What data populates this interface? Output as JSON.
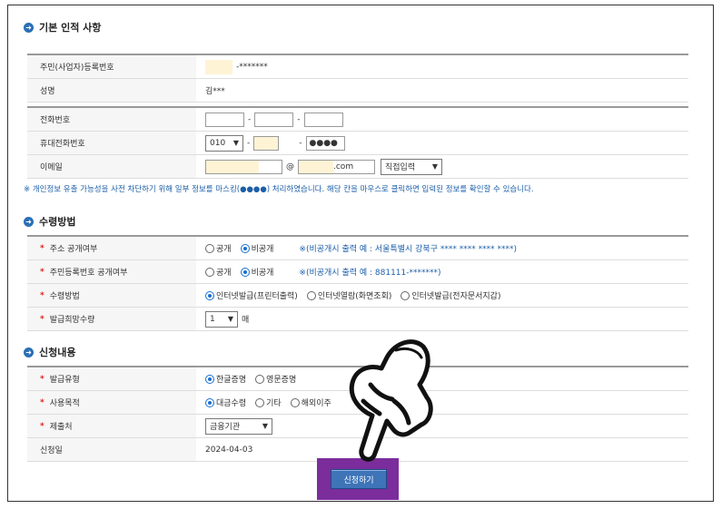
{
  "section1": {
    "title": "기본 인적 사항",
    "resident_label": "주민(사업자)등록번호",
    "resident_value": "-*******",
    "name_label": "성명",
    "name_value": "김***",
    "phone_label": "전화번호",
    "mobile_label": "휴대전화번호",
    "mobile_prefix": "010",
    "mobile_last": "●●●●",
    "email_label": "이메일",
    "email_at": "@",
    "email_domain": ".com",
    "email_select": "직접입력",
    "dash": "-"
  },
  "notice": "※ 개인정보 유출 가능성을 사전 차단하기 위해 일부 정보를 마스킹(●●●●) 처리하였습니다. 해당 칸을 마우스로 클릭하면 입력된 정보를 확인할 수 있습니다.",
  "section2": {
    "title": "수령방법",
    "addr_label": "주소 공개여부",
    "addr_opt1": "공개",
    "addr_opt2": "비공개",
    "addr_note": "※(비공개시 출력 예 : 서울특별시 강북구 **** **** **** ****)",
    "resident_label": "주민등록번호 공개여부",
    "resident_opt1": "공개",
    "resident_opt2": "비공개",
    "resident_note": "※(비공개시 출력 예 : 881111-*******)",
    "method_label": "수령방법",
    "method_opt1": "인터넷발급(프린터출력)",
    "method_opt2": "인터넷열람(화면조회)",
    "method_opt3": "인터넷발급(전자문서지갑)",
    "qty_label": "발급희망수량",
    "qty_value": "1",
    "qty_unit": "매"
  },
  "section3": {
    "title": "신청내용",
    "type_label": "발급유형",
    "type_opt1": "한글증명",
    "type_opt2": "영문증명",
    "purpose_label": "사용목적",
    "purpose_opt1": "대금수령",
    "purpose_opt2": "기타",
    "purpose_opt3": "해외이주",
    "submit_label": "제출처",
    "submit_value": "금융기관",
    "date_label": "신청일",
    "date_value": "2024-04-03"
  },
  "apply_button": "신청하기",
  "required_mark": "*",
  "colors": {
    "accent": "#2a6fb5",
    "button": "#3e74b8",
    "highlight_border": "#7b2d9c",
    "required": "#dd2222",
    "masked_field": "#fff3d6"
  }
}
